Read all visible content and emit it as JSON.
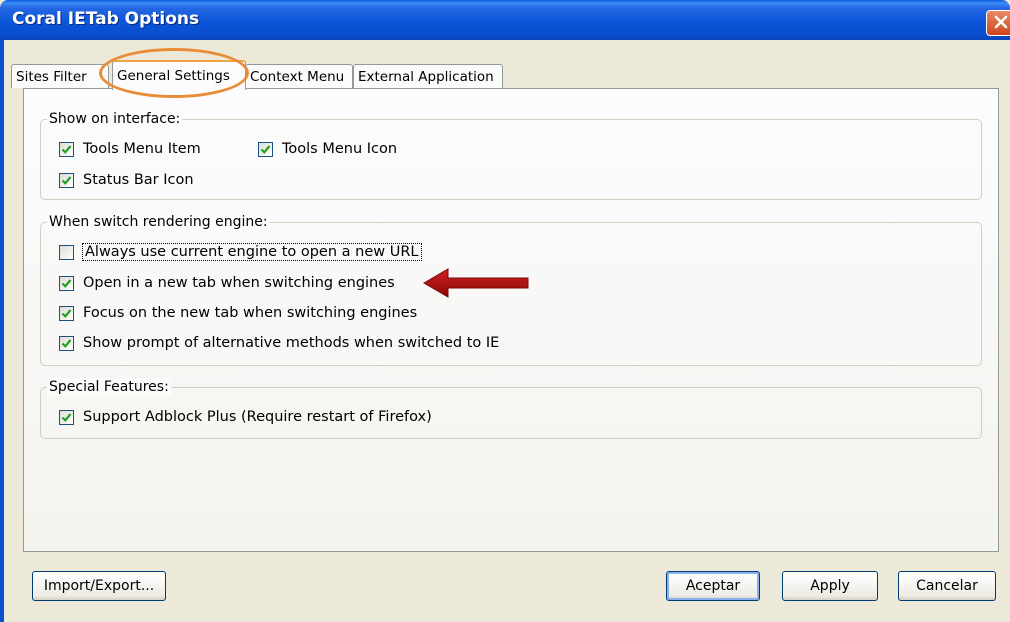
{
  "window": {
    "title": "Coral IETab Options",
    "close_icon": "close-icon"
  },
  "tabs": [
    {
      "label": "Sites Filter"
    },
    {
      "label": "General Settings"
    },
    {
      "label": "Context Menu"
    },
    {
      "label": "External Application"
    }
  ],
  "groups": {
    "interface": {
      "legend": "Show on interface:",
      "items": [
        {
          "label": "Tools Menu Item",
          "checked": true
        },
        {
          "label": "Tools Menu Icon",
          "checked": true
        },
        {
          "label": "Status Bar Icon",
          "checked": true
        }
      ]
    },
    "engine": {
      "legend": "When switch rendering engine:",
      "items": [
        {
          "label": "Always use current engine to open a new URL",
          "checked": false
        },
        {
          "label": "Open in a new tab when switching engines",
          "checked": true
        },
        {
          "label": "Focus on the new tab when switching engines",
          "checked": true
        },
        {
          "label": "Show prompt of alternative methods when switched to IE",
          "checked": true
        }
      ]
    },
    "special": {
      "legend": "Special Features:",
      "items": [
        {
          "label": "Support Adblock Plus (Require restart of Firefox)",
          "checked": true
        }
      ]
    }
  },
  "buttons": {
    "import_export": "Import/Export...",
    "ok": "Aceptar",
    "apply": "Apply",
    "cancel": "Cancelar"
  },
  "colors": {
    "titlebar": "#0a55d8",
    "highlight": "#e98c37",
    "arrow": "#b01010",
    "check": "#21a121"
  }
}
